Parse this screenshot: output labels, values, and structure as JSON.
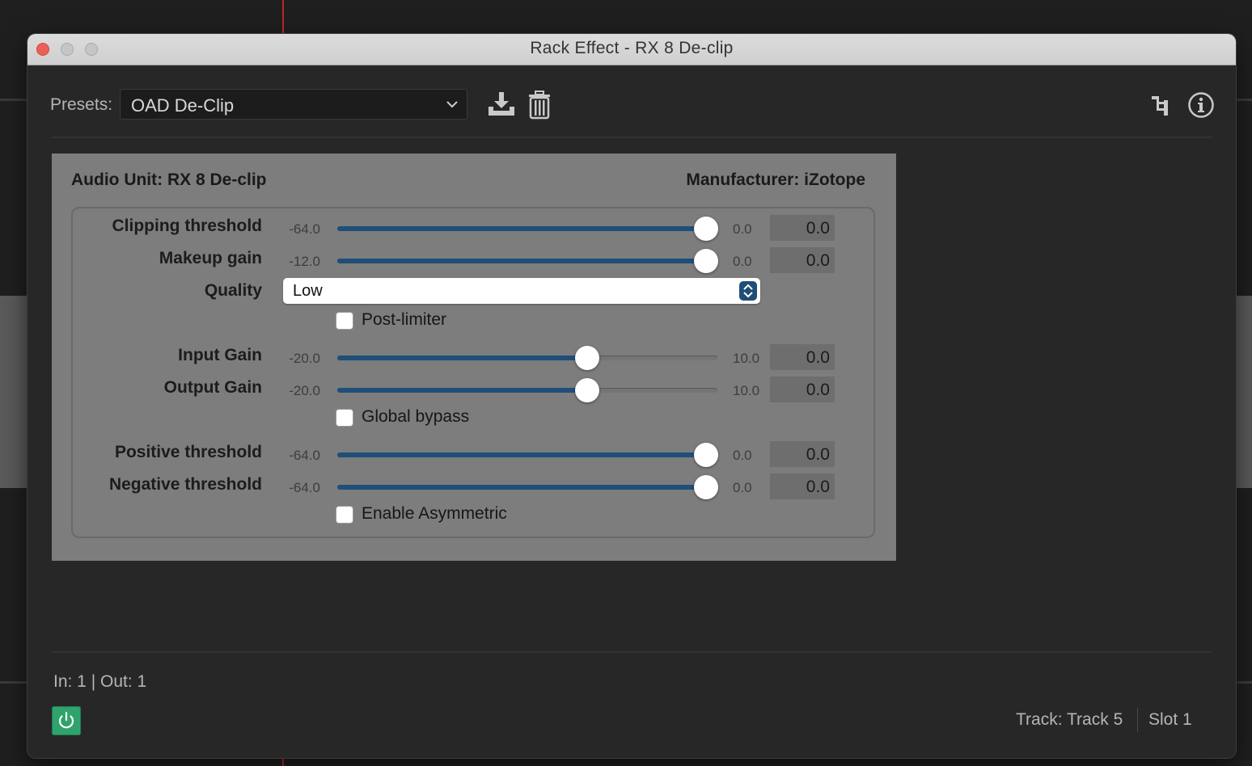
{
  "window": {
    "title": "Rack Effect - RX 8 De-clip"
  },
  "presets": {
    "label": "Presets:",
    "value": "OAD De-Clip"
  },
  "plugin": {
    "audio_unit": "Audio Unit: RX 8 De-clip",
    "manufacturer": "Manufacturer: iZotope",
    "params": {
      "clipping_threshold": {
        "label": "Clipping threshold",
        "min": "-64.0",
        "max": "0.0",
        "value": "0.0",
        "fraction": 1.0
      },
      "makeup_gain": {
        "label": "Makeup gain",
        "min": "-12.0",
        "max": "0.0",
        "value": "0.0",
        "fraction": 1.0
      },
      "quality": {
        "label": "Quality",
        "value": "Low"
      },
      "post_limiter": {
        "label": "Post-limiter",
        "checked": false
      },
      "input_gain": {
        "label": "Input Gain",
        "min": "-20.0",
        "max": "10.0",
        "value": "0.0",
        "fraction": 0.6667
      },
      "output_gain": {
        "label": "Output Gain",
        "min": "-20.0",
        "max": "10.0",
        "value": "0.0",
        "fraction": 0.6667
      },
      "global_bypass": {
        "label": "Global bypass",
        "checked": false
      },
      "positive_threshold": {
        "label": "Positive threshold",
        "min": "-64.0",
        "max": "0.0",
        "value": "0.0",
        "fraction": 1.0
      },
      "negative_threshold": {
        "label": "Negative threshold",
        "min": "-64.0",
        "max": "0.0",
        "value": "0.0",
        "fraction": 1.0
      },
      "enable_asymmetric": {
        "label": "Enable Asymmetric",
        "checked": false
      }
    }
  },
  "footer": {
    "io": "In: 1 | Out: 1",
    "track": "Track: Track 5",
    "slot": "Slot 1",
    "power_on": true
  },
  "colors": {
    "slider_fill": "#1f4e79",
    "power_green": "#2fa36b",
    "close_red": "#ec5f57",
    "panel_gray": "#7d7d7d"
  },
  "icons": [
    "save-preset-icon",
    "delete-preset-icon",
    "routing-icon",
    "info-icon",
    "power-icon",
    "chevron-down-icon",
    "stepper-icon"
  ]
}
